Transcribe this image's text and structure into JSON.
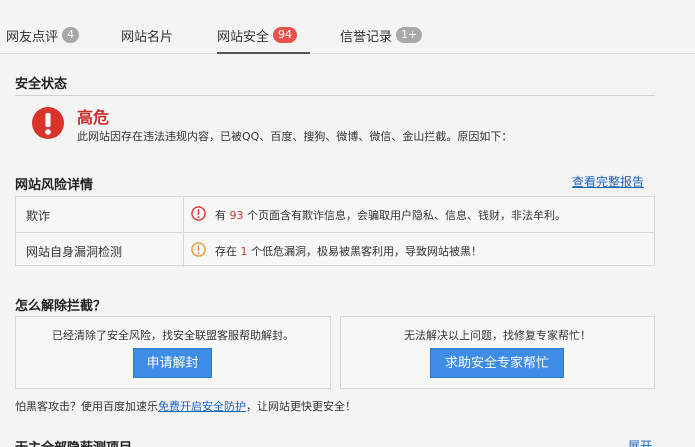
{
  "tabs": [
    {
      "label": "网友点评",
      "badge": "4"
    },
    {
      "label": "网站名片",
      "badge": ""
    },
    {
      "label": "网站安全",
      "badge": "94"
    },
    {
      "label": "信誉记录",
      "badge": "1+"
    }
  ],
  "security_status": {
    "title": "安全状态",
    "level": "高危",
    "description": "此网站因存在违法违规内容，已被QQ、百度、搜狗、微博、微信、金山拦截。原因如下："
  },
  "risk_details": {
    "title": "网站风险详情",
    "report_link": "查看完整报告",
    "rows": [
      {
        "name": "欺诈",
        "pre": "有 ",
        "count": "93",
        "post": " 个页面含有欺诈信息，会骗取用户隐私、信息、钱财，非法牟利。"
      },
      {
        "name": "网站自身漏洞检测",
        "pre": "存在 ",
        "count": "1",
        "post": " 个低危漏洞，极易被黑客利用，导致网站被黑！"
      }
    ]
  },
  "unblock": {
    "title": "怎么解除拦截？",
    "left_text": "已经清除了安全风险，找安全联盟客服帮助解封。",
    "left_button": "申请解封",
    "right_text": "无法解决以上问题，找修复专家帮忙！",
    "right_button": "求助安全专家帮忙"
  },
  "footer": {
    "pre": "怕黑客攻击？使用百度加速乐",
    "link": "免费开启安全防护",
    "post": "，让网站更快更安全！"
  },
  "next_section": {
    "title": "无主全部隐蔽测项目",
    "link": "展开"
  },
  "colors": {
    "danger": "#c9302c",
    "link": "#1a64c4",
    "button": "#3d8de6",
    "badge_red": "#e8544b",
    "badge_gray": "#a8a8a8"
  }
}
